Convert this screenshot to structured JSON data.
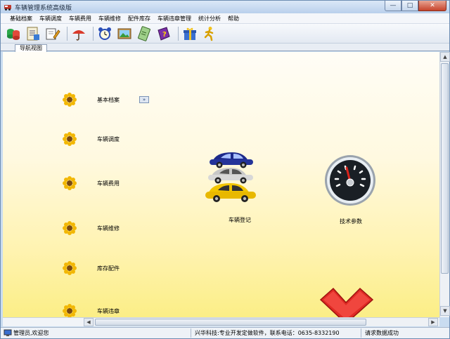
{
  "window": {
    "title": "车辆管理系统高级版",
    "min": "—",
    "max": "□",
    "close": "✕"
  },
  "menu": [
    "基础档案",
    "车辆调度",
    "车辆费用",
    "车辆维修",
    "配件库存",
    "车辆违章管理",
    "统计分析",
    "帮助"
  ],
  "toolbar": [
    "database-icon",
    "notes-icon",
    "edit-icon",
    "umbrella-icon",
    "alarm-clock-icon",
    "picture-icon",
    "notepad-icon",
    "help-book-icon",
    "gift-icon",
    "runner-icon"
  ],
  "tab": {
    "label": "导航视图"
  },
  "nav": {
    "items": [
      "基本档案",
      "车辆调度",
      "车辆费用",
      "车辆维修",
      "库存配件",
      "车辆违章"
    ],
    "expand": "»"
  },
  "tiles": {
    "car": "车辆登记",
    "gauge": "技术参数"
  },
  "status": {
    "user": "管理员,欢迎您",
    "company": "兴华科技:专业开发定做软件，联系电话：0635-8332190",
    "message": "请求数据成功"
  },
  "colors": {
    "accent": "#c9dcf0",
    "content_bottom": "#fbee86",
    "close_button": "#c6432b"
  }
}
